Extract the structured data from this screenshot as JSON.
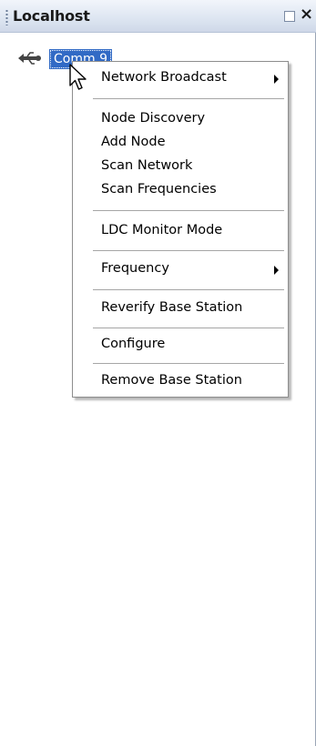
{
  "panel": {
    "title": "Localhost"
  },
  "tree": {
    "node_label": "Comm 9"
  },
  "context_menu": {
    "items": [
      {
        "label": "Network Broadcast",
        "submenu": true
      },
      {
        "label": "Node Discovery",
        "submenu": false
      },
      {
        "label": "Add Node",
        "submenu": false
      },
      {
        "label": "Scan Network",
        "submenu": false
      },
      {
        "label": "Scan Frequencies",
        "submenu": false
      },
      {
        "label": "LDC Monitor Mode",
        "submenu": false
      },
      {
        "label": "Frequency",
        "submenu": true
      },
      {
        "label": "Reverify Base Station",
        "submenu": false
      },
      {
        "label": "Configure",
        "submenu": false
      },
      {
        "label": "Remove Base Station",
        "submenu": false
      }
    ]
  },
  "icons": {
    "titlebar": [
      "grip-icon",
      "restore-icon",
      "close-icon"
    ],
    "tree_node": "usb-icon",
    "pointer": "cursor-arrow-icon"
  },
  "colors": {
    "selection": "#316ac5",
    "titlebar": "#dde5f1",
    "menu_border": "#8d8d8d"
  }
}
